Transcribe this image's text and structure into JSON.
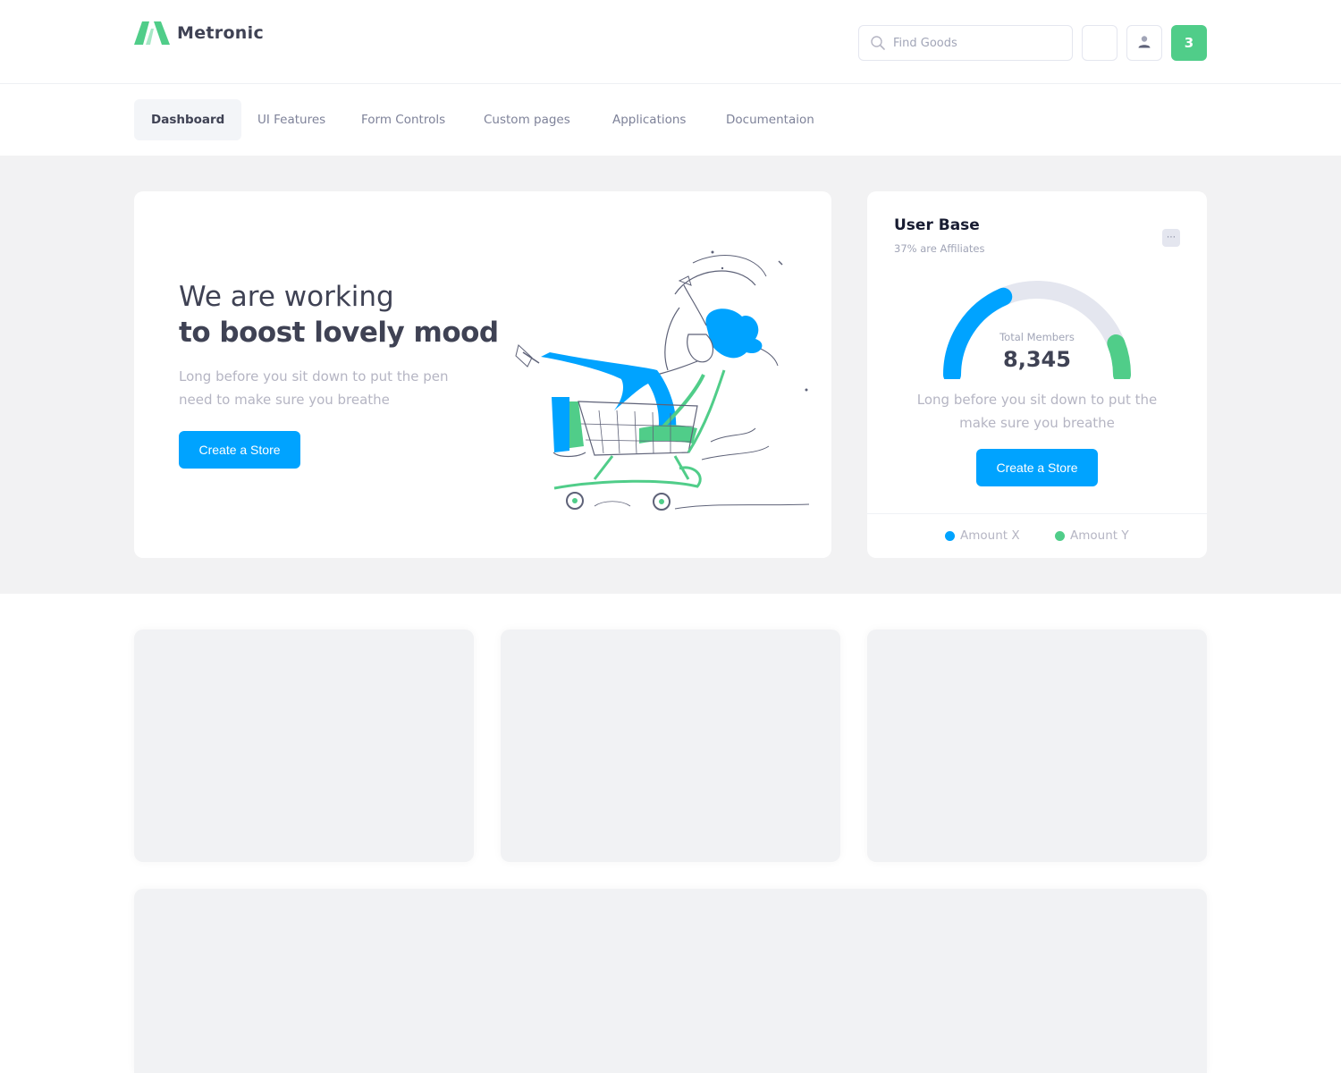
{
  "app": {
    "brand": "Metronic"
  },
  "header": {
    "search": {
      "placeholder": "Find Goods",
      "value": ""
    },
    "notifications_count": "3",
    "colors": {
      "accent_green": "#50cd89",
      "primary_blue": "#00a3ff"
    }
  },
  "nav": {
    "items": [
      {
        "label": "Dashboard",
        "active": true
      },
      {
        "label": "UI Features",
        "active": false
      },
      {
        "label": "Form Controls",
        "active": false
      },
      {
        "label": "Custom pages",
        "active": false
      },
      {
        "label": "Applications",
        "active": false
      },
      {
        "label": "Documentaion",
        "active": false
      }
    ]
  },
  "hero": {
    "line1": "We are working",
    "line2": "to boost lovely mood",
    "description": "Long before you sit down to put the pen need to make sure you breathe",
    "button_label": "Create a Store",
    "illustration": "person-riding-shopping-cart-illustration"
  },
  "user_base": {
    "title": "User Base",
    "subtitle": "37% are Affiliates",
    "more_icon": "more-dots-icon",
    "gauge_label": "Total Members",
    "gauge_value": "8,345",
    "description": "Long before you sit down to put the make sure you breathe",
    "button_label": "Create a Store",
    "legend": [
      {
        "label": "Amount X",
        "color": "#00a3ff"
      },
      {
        "label": "Amount Y",
        "color": "#50cd89"
      }
    ]
  },
  "chart_data": {
    "type": "radial-gauge",
    "series": [
      {
        "name": "Amount X",
        "fraction": 0.37
      },
      {
        "name": "Amount Y",
        "fraction": 0.12
      }
    ],
    "total_label": "Total Members",
    "total": 8345
  }
}
